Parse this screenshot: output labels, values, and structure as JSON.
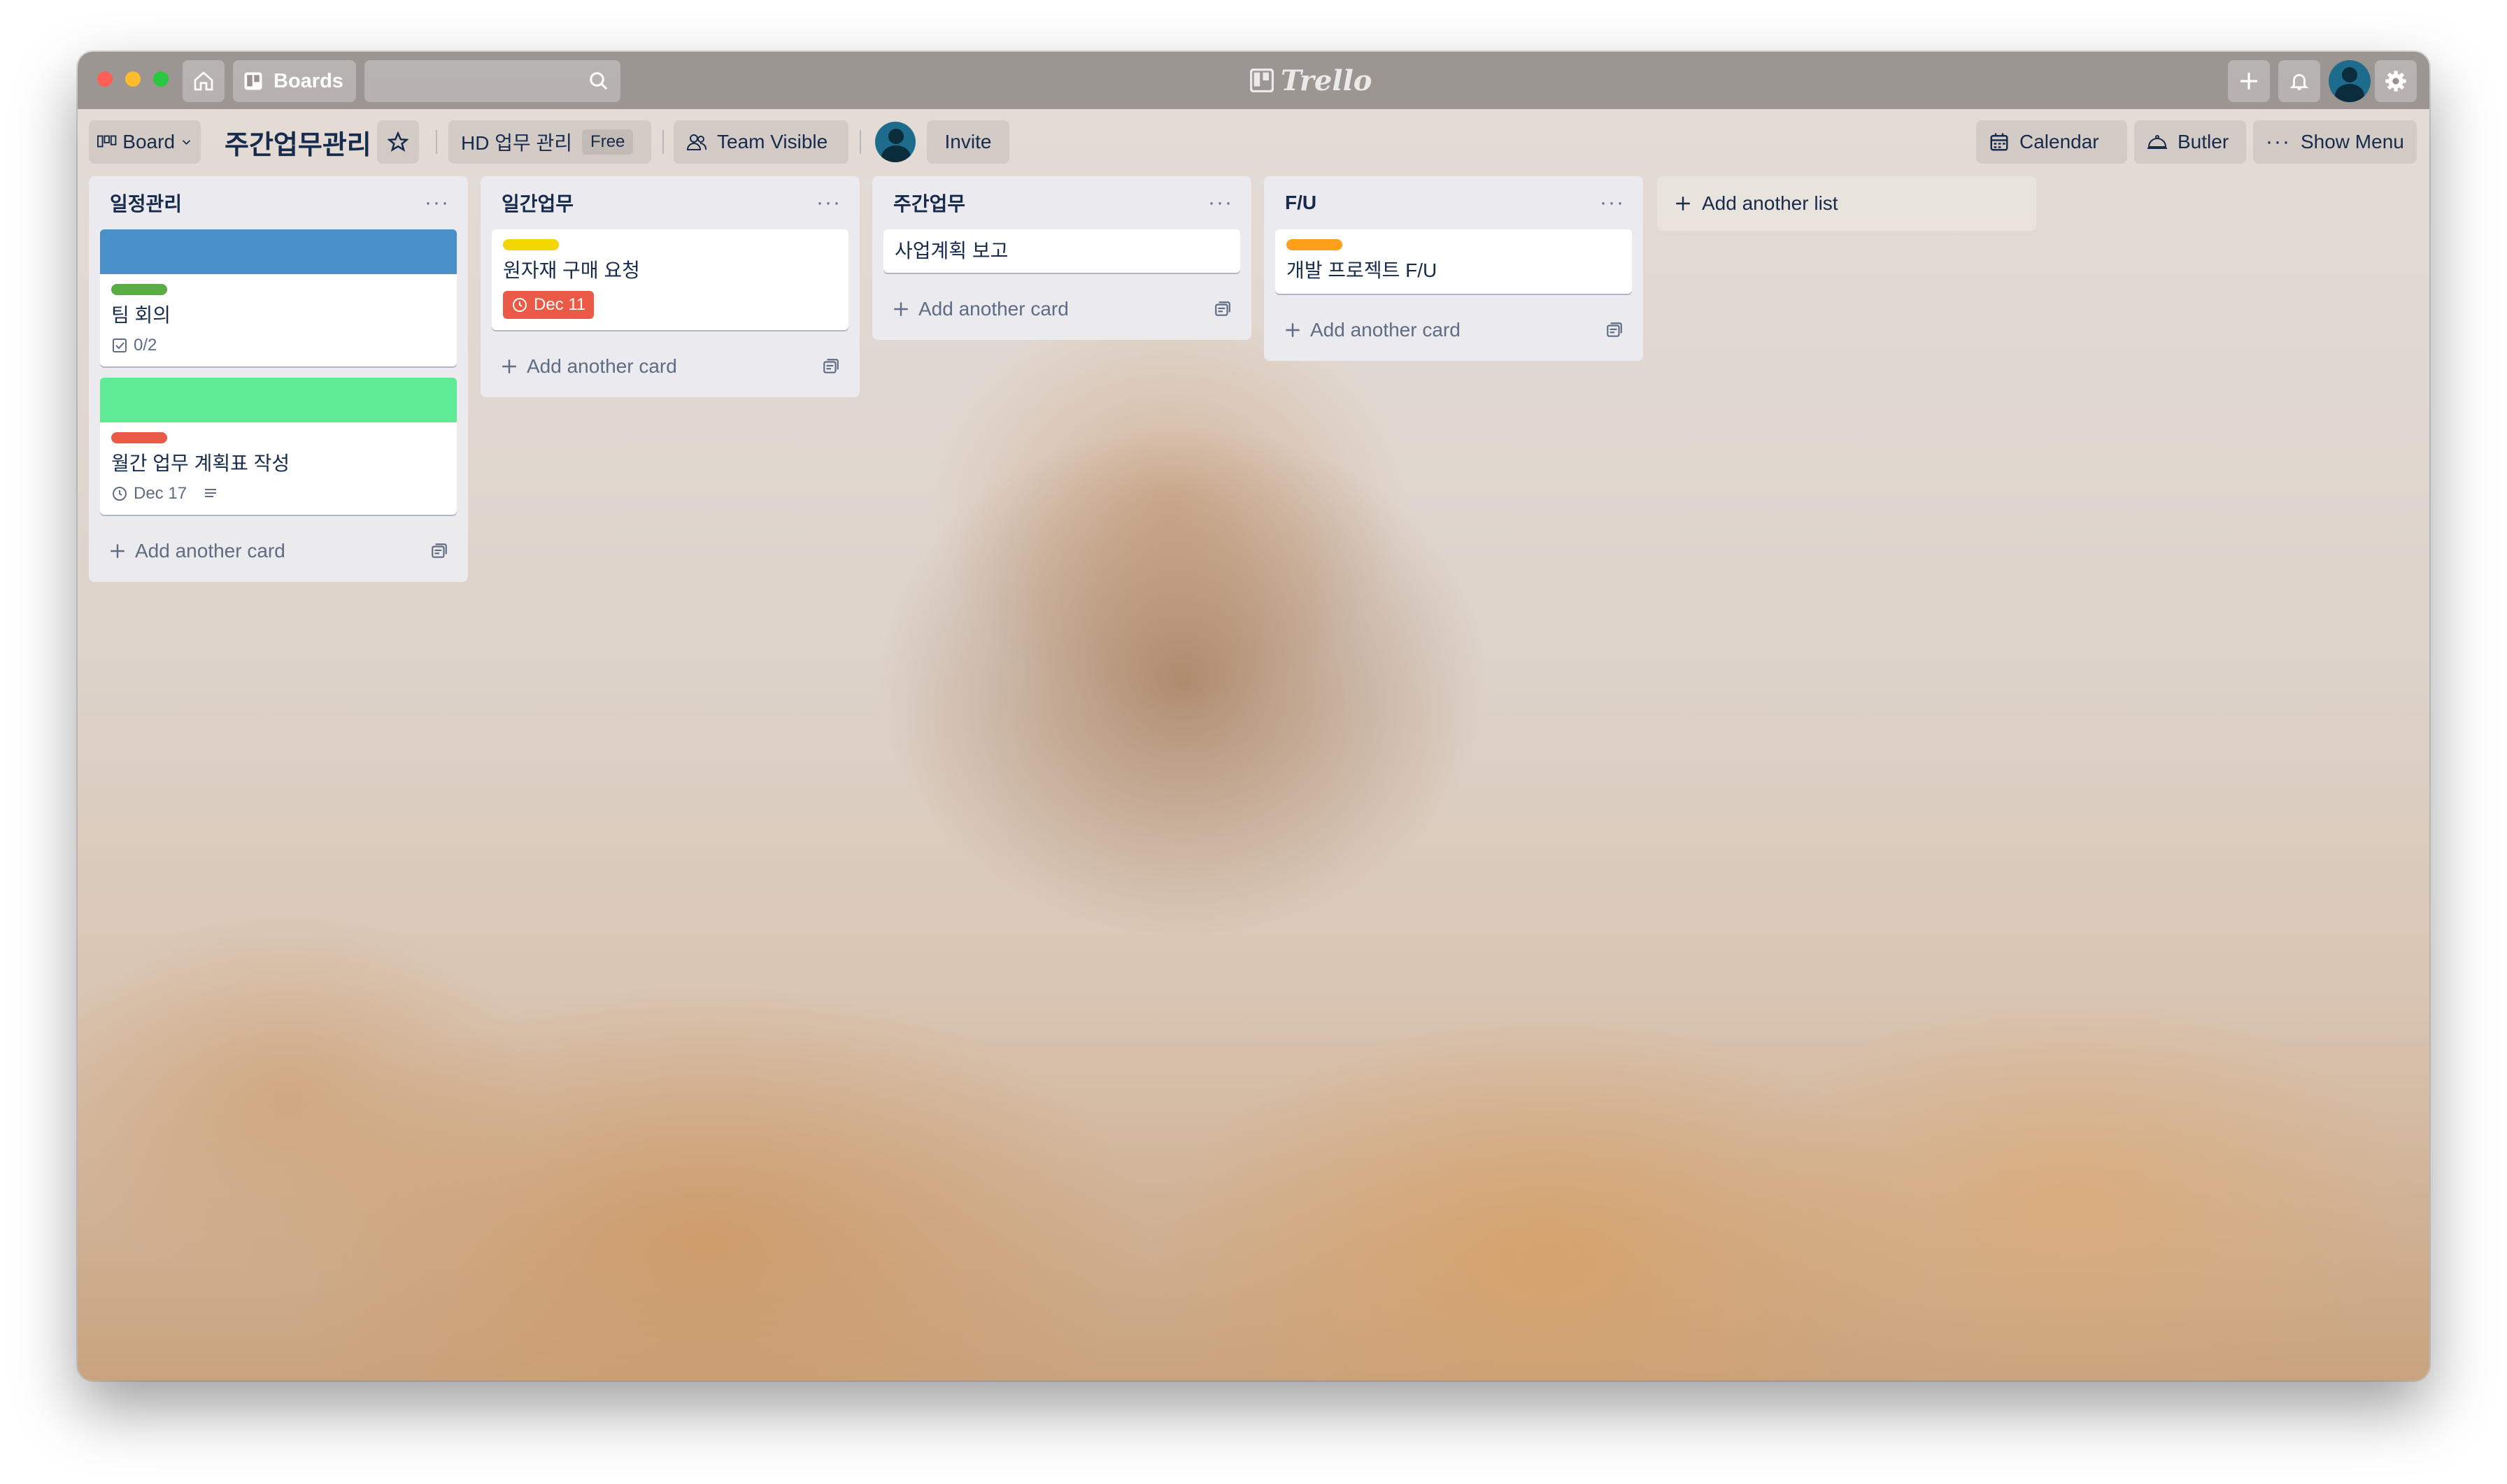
{
  "titlebar": {
    "boards_label": "Boards",
    "logo_text": "Trello"
  },
  "board_header": {
    "view_label": "Board",
    "title": "주간업무관리",
    "team_name": "HD 업무 관리",
    "plan_badge": "Free",
    "visibility": "Team Visible",
    "invite_label": "Invite",
    "calendar_label": "Calendar",
    "butler_label": "Butler",
    "show_menu_label": "Show Menu"
  },
  "lists": [
    {
      "title": "일정관리",
      "menu": "···",
      "cards": [
        {
          "cover_color": "#4a90c8",
          "label_color": "#5aac44",
          "title": "팀 회의",
          "checklist": "0/2"
        },
        {
          "cover_color": "#5fea95",
          "label_color": "#eb5a46",
          "title": "월간 업무 계획표 작성",
          "due": "Dec 17"
        }
      ],
      "add_card": "Add another card"
    },
    {
      "title": "일간업무",
      "menu": "···",
      "cards": [
        {
          "label_color": "#f2d600",
          "title": "원자재 구매 요청",
          "due": "Dec 11"
        }
      ],
      "add_card": "Add another card"
    },
    {
      "title": "주간업무",
      "menu": "···",
      "cards": [
        {
          "title": "사업계획 보고"
        }
      ],
      "add_card": "Add another card"
    },
    {
      "title": "F/U",
      "menu": "···",
      "cards": [
        {
          "label_color": "#ff9f1a",
          "title": "개발 프로젝트 F/U"
        }
      ],
      "add_card": "Add another card"
    }
  ],
  "add_list": "Add another list",
  "colors": {
    "due_overdue": "#eb5a46",
    "text_primary": "#172b4d",
    "text_muted": "#5e6c84"
  }
}
